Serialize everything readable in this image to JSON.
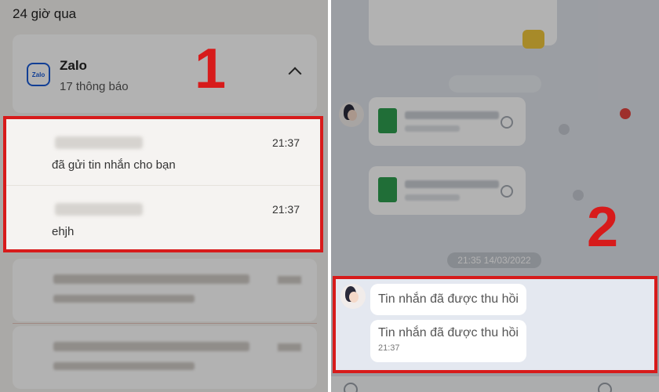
{
  "left_panel": {
    "section_title": "24 giờ qua",
    "app_group": {
      "logo_text": "Zalo",
      "app_name": "Zalo",
      "count_text": "17 thông báo"
    },
    "notifications": [
      {
        "time": "21:37",
        "message": "đã gửi tin nhắn cho bạn"
      },
      {
        "time": "21:37",
        "message": "ehjh"
      }
    ],
    "callout_number": "1"
  },
  "right_panel": {
    "date_separator": "21:35 14/03/2022",
    "recalled_messages": [
      {
        "text": "Tin nhắn đã được thu hồi",
        "time": ""
      },
      {
        "text": "Tin nhắn đã được thu hồi",
        "time": "21:37"
      }
    ],
    "callout_number": "2"
  },
  "colors": {
    "highlight_border": "#d71b1b",
    "zalo_blue": "#1a5bd6",
    "file_icon_green": "#2f9e4f"
  }
}
